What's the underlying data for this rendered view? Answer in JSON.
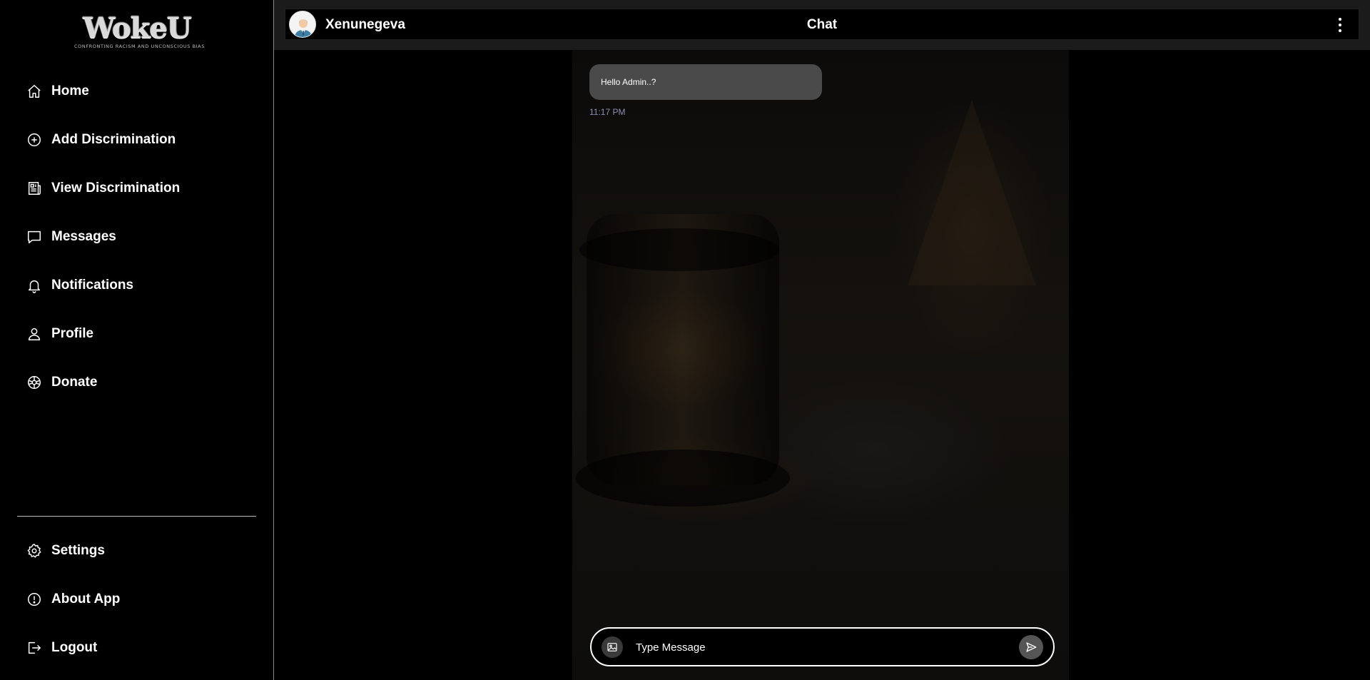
{
  "app": {
    "logo_text": "WokeU",
    "logo_tagline": "CONFRONTING RACISM AND UNCONSCIOUS BIAS"
  },
  "sidebar": {
    "items": [
      {
        "label": "Home",
        "icon": "home-icon"
      },
      {
        "label": "Add Discrimination",
        "icon": "plus-circle-icon"
      },
      {
        "label": "View Discrimination",
        "icon": "newspaper-icon"
      },
      {
        "label": "Messages",
        "icon": "chat-bubble-icon"
      },
      {
        "label": "Notifications",
        "icon": "bell-icon"
      },
      {
        "label": "Profile",
        "icon": "user-icon"
      },
      {
        "label": "Donate",
        "icon": "donate-icon"
      }
    ],
    "bottom_items": [
      {
        "label": "Settings",
        "icon": "gear-icon"
      },
      {
        "label": "About App",
        "icon": "info-icon"
      },
      {
        "label": "Logout",
        "icon": "logout-icon"
      }
    ]
  },
  "header": {
    "contact_name": "Xenunegeva",
    "title": "Chat"
  },
  "chat": {
    "messages": [
      {
        "text": "Hello Admin..?",
        "time": "11:17 PM"
      }
    ]
  },
  "composer": {
    "placeholder": "Type Message"
  },
  "colors": {
    "background": "#000000",
    "bubble": "#4a4a4a",
    "timestamp": "#8a8fb0",
    "header_bar": "#1b1b1b"
  }
}
